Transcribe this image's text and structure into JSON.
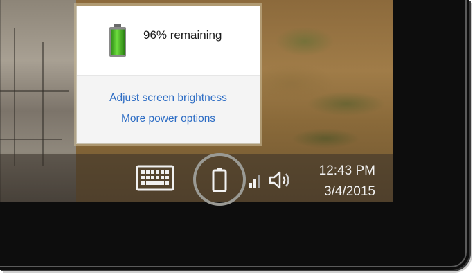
{
  "flyout": {
    "remaining": "96% remaining",
    "battery_level": 0.96,
    "adjust_brightness_link": "Adjust screen brightness",
    "power_options_link": "More power options"
  },
  "taskbar": {
    "time": "12:43 PM",
    "date": "3/4/2015",
    "icons": [
      "touch-keyboard-icon",
      "battery-icon",
      "signal-icon",
      "volume-icon"
    ]
  },
  "colors": {
    "link": "#2c6cc4",
    "battery_green": "#3cb521",
    "highlight_ring": "#9a9a94"
  }
}
